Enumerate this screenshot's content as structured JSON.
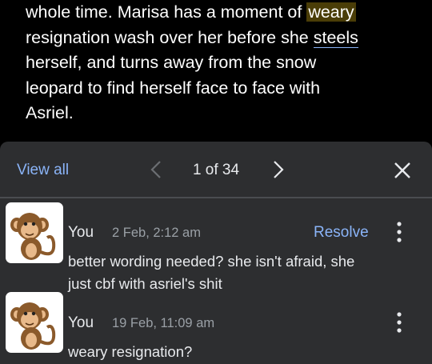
{
  "document": {
    "lines": [
      {
        "before": "whole time. Marisa has a moment of ",
        "highlight": "weary",
        "after": ""
      },
      {
        "before": "resignation wash over her before she ",
        "underline": "steels",
        "after": ""
      },
      {
        "before": "herself, and turns away from the snow",
        "after": ""
      },
      {
        "before": "leopard to find herself face to face with",
        "after": ""
      },
      {
        "before": "Asriel.",
        "after": ""
      }
    ]
  },
  "panel": {
    "view_all": "View all",
    "counter": "1 of 34",
    "icons": {
      "prev": "chevron-left-icon",
      "next": "chevron-right-icon",
      "close": "close-icon",
      "more": "more-vert-icon"
    }
  },
  "comments": [
    {
      "author": "You",
      "time": "2 Feb, 2:12 am",
      "resolve_label": "Resolve",
      "body": [
        "better wording needed? she isn't afraid, she",
        "just cbf with asriel's shit"
      ],
      "avatar_icon": "monkey-avatar"
    },
    {
      "author": "You",
      "time": "19 Feb, 11:09 am",
      "body": [
        "weary resignation?"
      ],
      "avatar_icon": "monkey-avatar"
    }
  ],
  "colors": {
    "background": "#000000",
    "panel": "#2d2e30",
    "accent": "#8ab4f8",
    "highlight": "#4a3d07",
    "text_secondary": "#9aa0a6"
  }
}
